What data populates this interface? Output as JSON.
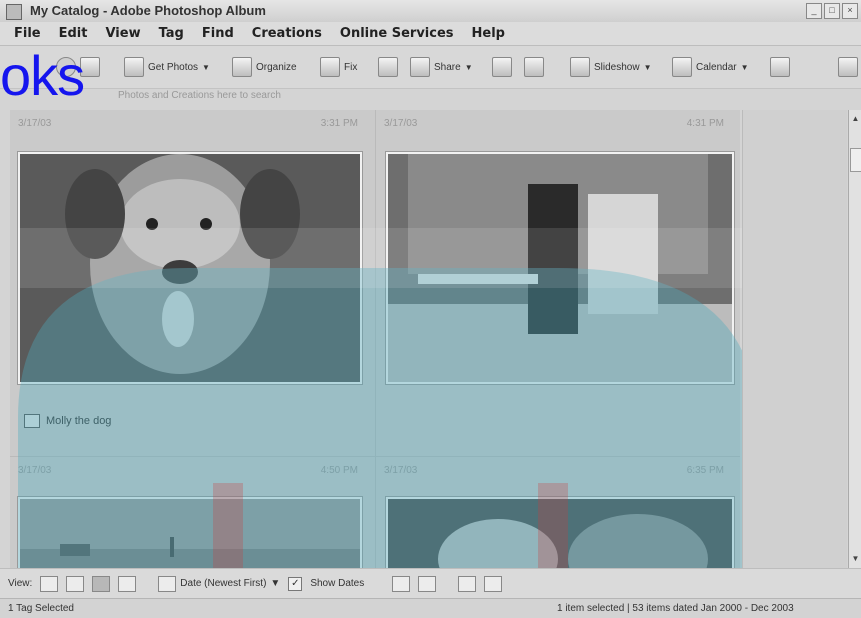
{
  "window": {
    "title": "My Catalog - Adobe Photoshop Album"
  },
  "menu": [
    "File",
    "Edit",
    "View",
    "Tag",
    "Find",
    "Creations",
    "Online Services",
    "Help"
  ],
  "toolbar": {
    "get_photos": "Get Photos",
    "organize": "Organize",
    "fix": "Fix",
    "share": "Share",
    "slideshow": "Slideshow",
    "calendar": "Calendar"
  },
  "overlay_text": "oks",
  "search_hint": "Photos and Creations here to search",
  "cells": [
    {
      "date": "3/17/03",
      "time": "3:31 PM",
      "caption": "Molly the dog",
      "photo": "dog-photo"
    },
    {
      "date": "3/17/03",
      "time": "4:31 PM",
      "caption": "",
      "photo": "locker-room-photo"
    },
    {
      "date": "3/17/03",
      "time": "4:50 PM",
      "caption": "",
      "photo": "outdoor-photo"
    },
    {
      "date": "3/17/03",
      "time": "6:35 PM",
      "caption": "",
      "photo": "dog-closeup-photo"
    }
  ],
  "bottom": {
    "view_label": "View:",
    "sort": "Date (Newest First)",
    "show_dates": "Show Dates"
  },
  "status": {
    "left": "1 Tag Selected",
    "right": "1 item selected  |  53 items dated Jan 2000 - Dec 2003"
  }
}
